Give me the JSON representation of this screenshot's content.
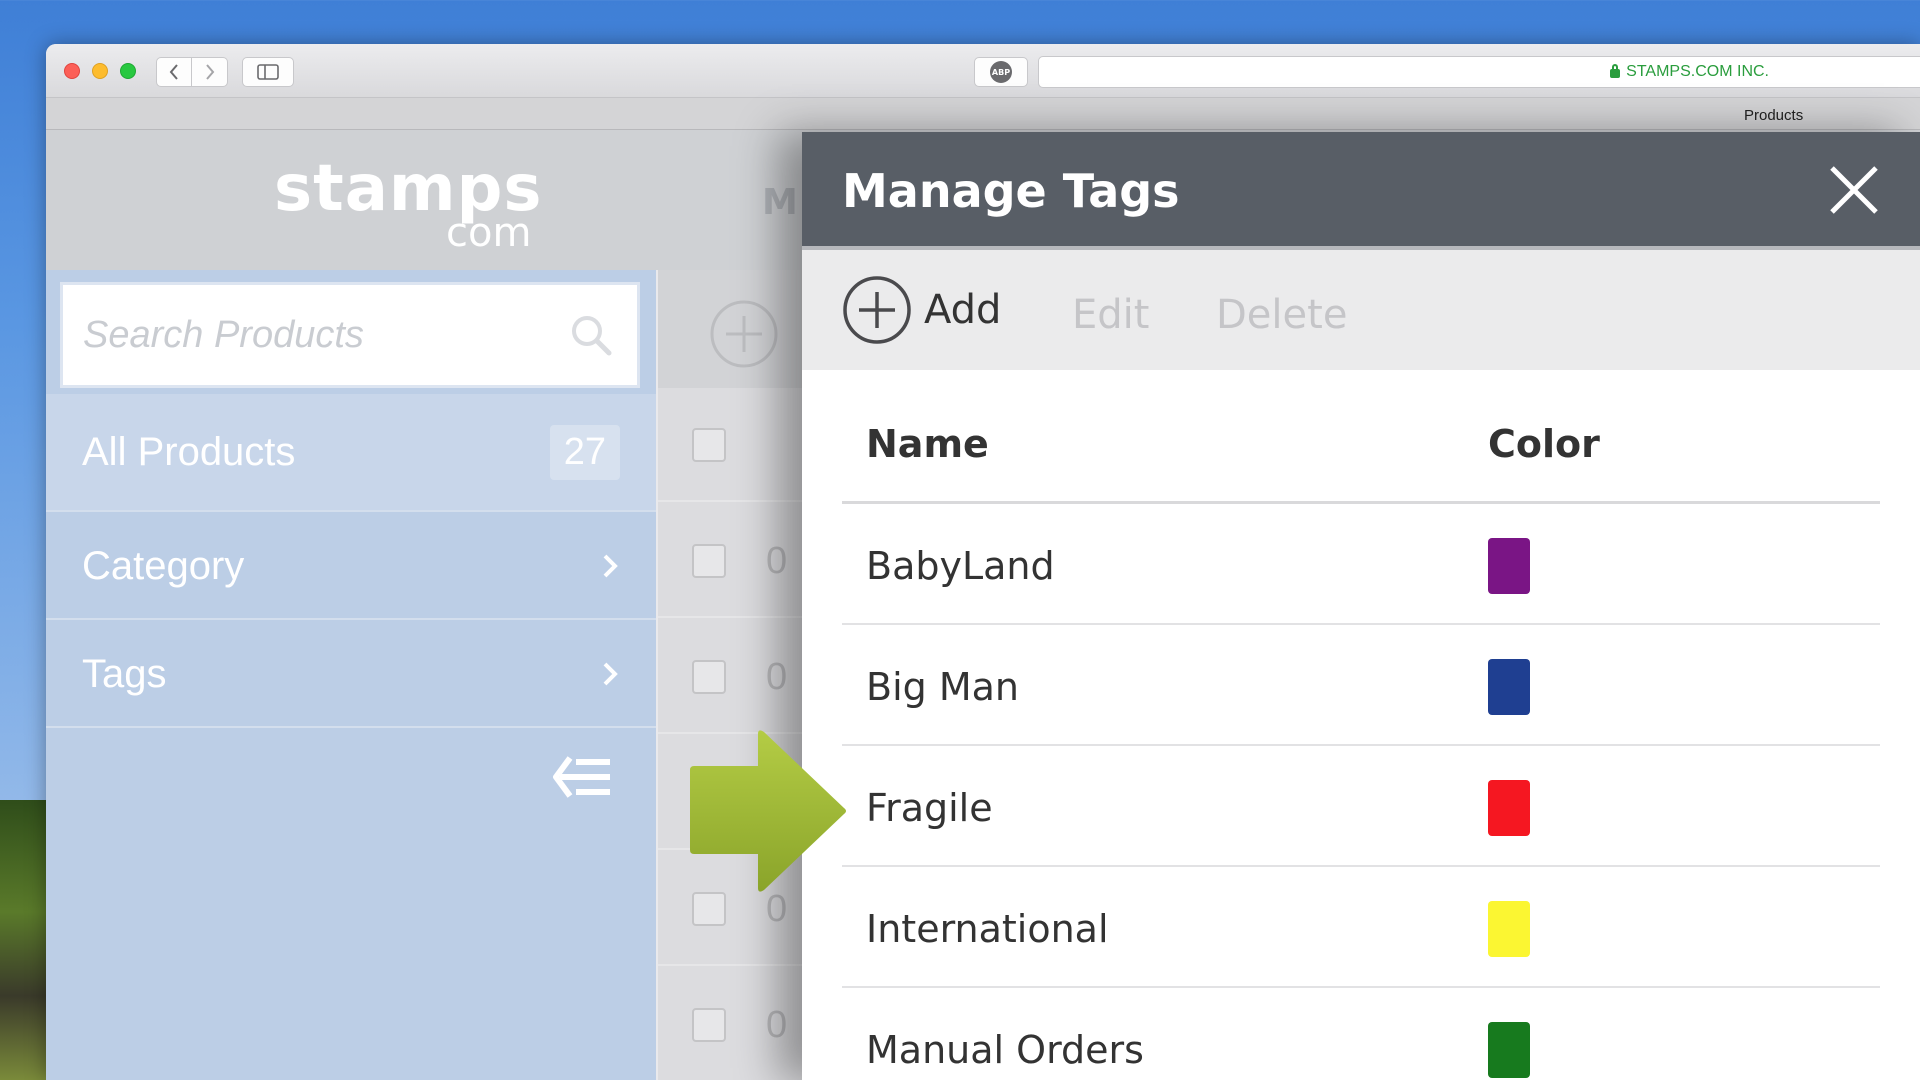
{
  "browser": {
    "url_org": "STAMPS.COM INC.",
    "tab_title": "Products",
    "adblock_badge": "ABP"
  },
  "app": {
    "logo_main": "stamps",
    "logo_com": "com",
    "header_partial": "M"
  },
  "sidebar": {
    "search_placeholder": "Search Products",
    "items": [
      {
        "label": "All Products",
        "count": "27"
      },
      {
        "label": "Category"
      },
      {
        "label": "Tags"
      }
    ]
  },
  "content": {
    "rows": [
      {
        "text": "0"
      },
      {
        "text": "0"
      },
      {
        "text": "0"
      },
      {
        "text": "0"
      }
    ]
  },
  "modal": {
    "title": "Manage Tags",
    "actions": {
      "add": "Add",
      "edit": "Edit",
      "delete": "Delete"
    },
    "columns": {
      "name": "Name",
      "color": "Color"
    },
    "tags": [
      {
        "name": "BabyLand",
        "color": "#7a1585"
      },
      {
        "name": "Big Man",
        "color": "#1f3f91"
      },
      {
        "name": "Fragile",
        "color": "#f51721"
      },
      {
        "name": "International",
        "color": "#fbf632"
      },
      {
        "name": "Manual Orders",
        "color": "#177a1e"
      }
    ]
  },
  "colors": {
    "modal_header": "#585e66",
    "sidebar": "#bccee6",
    "arrow": "#9db834"
  }
}
